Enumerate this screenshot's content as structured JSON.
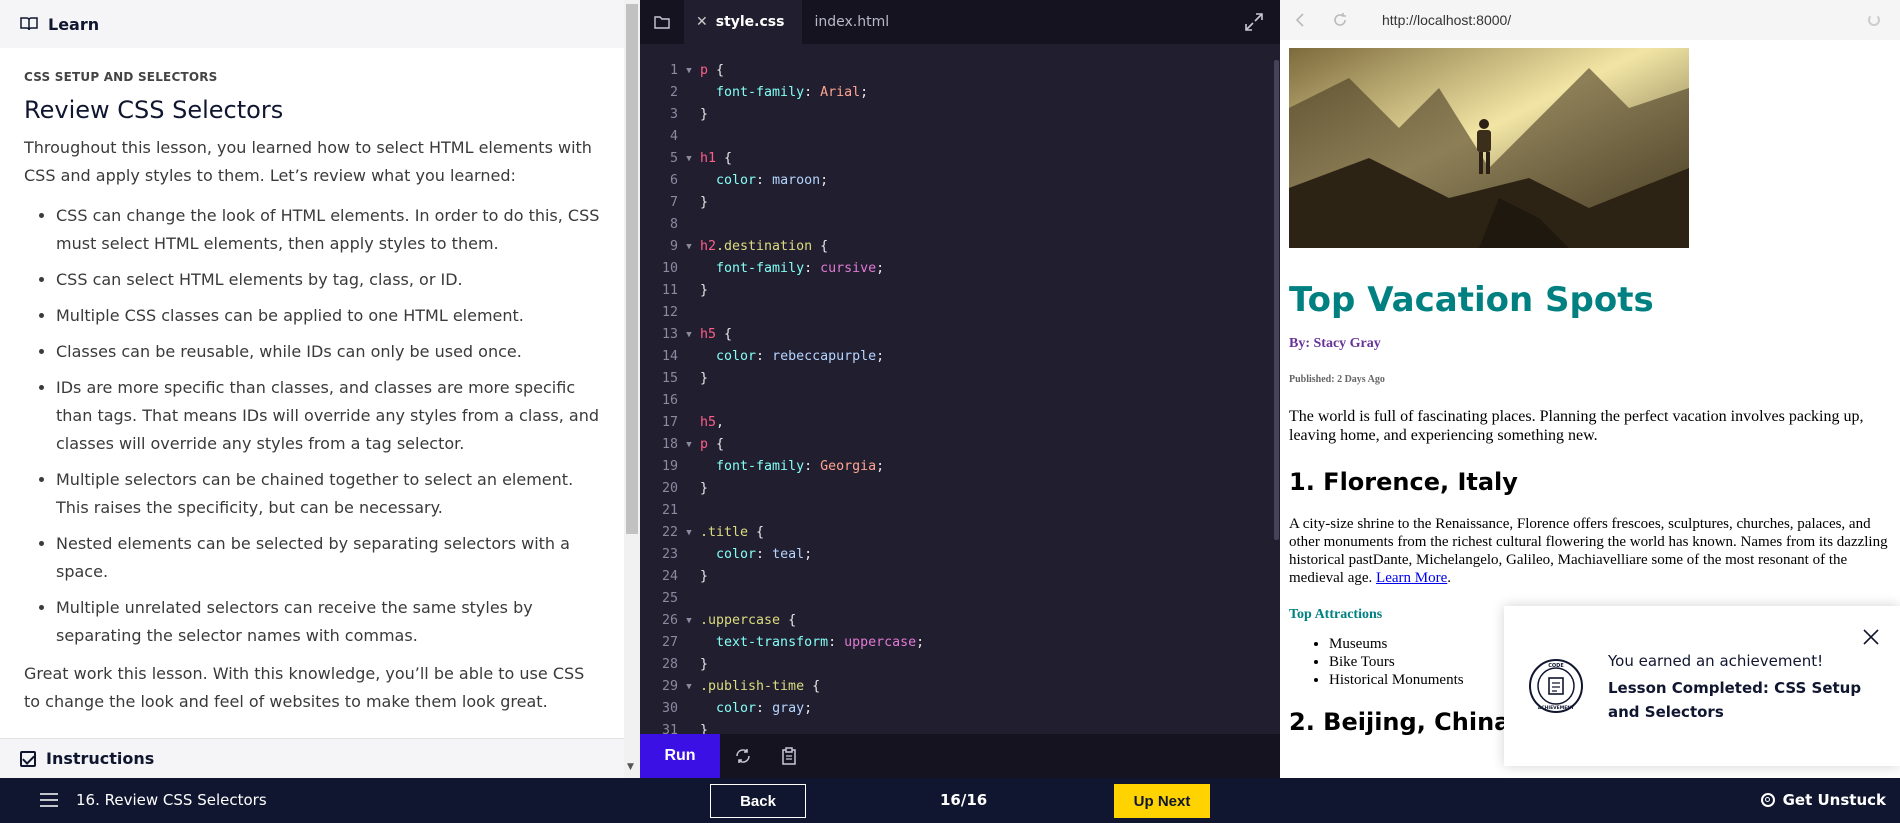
{
  "learn": {
    "header": "Learn",
    "eyebrow": "CSS SETUP AND SELECTORS",
    "title": "Review CSS Selectors",
    "intro": "Throughout this lesson, you learned how to select HTML elements with CSS and apply styles to them. Let’s review what you learned:",
    "bullets": [
      "CSS can change the look of HTML elements. In order to do this, CSS must select HTML elements, then apply styles to them.",
      "CSS can select HTML elements by tag, class, or ID.",
      "Multiple CSS classes can be applied to one HTML element.",
      "Classes can be reusable, while IDs can only be used once.",
      "IDs are more specific than classes, and classes are more specific than tags. That means IDs will override any styles from a class, and classes will override any styles from a tag selector.",
      "Multiple selectors can be chained together to select an element. This raises the specificity, but can be necessary.",
      "Nested elements can be selected by separating selectors with a space.",
      "Multiple unrelated selectors can receive the same styles by separating the selector names with commas."
    ],
    "outro": "Great work this lesson. With this knowledge, you’ll be able to use CSS to change the look and feel of websites to make them look great.",
    "instructions": "Instructions"
  },
  "editor": {
    "tabs": [
      {
        "label": "style.css",
        "active": true
      },
      {
        "label": "index.html",
        "active": false
      }
    ],
    "run_label": "Run",
    "lines": [
      {
        "n": "1",
        "fold": "▼",
        "parts": [
          [
            "t-sel",
            "p"
          ],
          [
            "t-pun",
            " {"
          ]
        ]
      },
      {
        "n": "2",
        "fold": "",
        "parts": [
          [
            "t-pun",
            "  "
          ],
          [
            "t-prop",
            "font-family"
          ],
          [
            "t-pun",
            ": "
          ],
          [
            "t-val",
            "Arial"
          ],
          [
            "t-pun",
            ";"
          ]
        ]
      },
      {
        "n": "3",
        "fold": "",
        "parts": [
          [
            "t-pun",
            "}"
          ]
        ]
      },
      {
        "n": "4",
        "fold": "",
        "parts": []
      },
      {
        "n": "5",
        "fold": "▼",
        "parts": [
          [
            "t-sel",
            "h1"
          ],
          [
            "t-pun",
            " {"
          ]
        ]
      },
      {
        "n": "6",
        "fold": "",
        "parts": [
          [
            "t-pun",
            "  "
          ],
          [
            "t-prop",
            "color"
          ],
          [
            "t-pun",
            ": "
          ],
          [
            "t-kw",
            "maroon"
          ],
          [
            "t-pun",
            ";"
          ]
        ]
      },
      {
        "n": "7",
        "fold": "",
        "parts": [
          [
            "t-pun",
            "}"
          ]
        ]
      },
      {
        "n": "8",
        "fold": "",
        "parts": []
      },
      {
        "n": "9",
        "fold": "▼",
        "parts": [
          [
            "t-sel",
            "h2"
          ],
          [
            "t-cls",
            ".destination"
          ],
          [
            "t-pun",
            " {"
          ]
        ]
      },
      {
        "n": "10",
        "fold": "",
        "parts": [
          [
            "t-pun",
            "  "
          ],
          [
            "t-prop",
            "font-family"
          ],
          [
            "t-pun",
            ": "
          ],
          [
            "t-mag",
            "cursive"
          ],
          [
            "t-pun",
            ";"
          ]
        ]
      },
      {
        "n": "11",
        "fold": "",
        "parts": [
          [
            "t-pun",
            "}"
          ]
        ]
      },
      {
        "n": "12",
        "fold": "",
        "parts": []
      },
      {
        "n": "13",
        "fold": "▼",
        "parts": [
          [
            "t-sel",
            "h5"
          ],
          [
            "t-pun",
            " {"
          ]
        ]
      },
      {
        "n": "14",
        "fold": "",
        "parts": [
          [
            "t-pun",
            "  "
          ],
          [
            "t-prop",
            "color"
          ],
          [
            "t-pun",
            ": "
          ],
          [
            "t-kw",
            "rebeccapurple"
          ],
          [
            "t-pun",
            ";"
          ]
        ]
      },
      {
        "n": "15",
        "fold": "",
        "parts": [
          [
            "t-pun",
            "}"
          ]
        ]
      },
      {
        "n": "16",
        "fold": "",
        "parts": []
      },
      {
        "n": "17",
        "fold": "",
        "parts": [
          [
            "t-sel",
            "h5"
          ],
          [
            "t-pun",
            ","
          ]
        ]
      },
      {
        "n": "18",
        "fold": "▼",
        "parts": [
          [
            "t-sel",
            "p"
          ],
          [
            "t-pun",
            " {"
          ]
        ]
      },
      {
        "n": "19",
        "fold": "",
        "parts": [
          [
            "t-pun",
            "  "
          ],
          [
            "t-prop",
            "font-family"
          ],
          [
            "t-pun",
            ": "
          ],
          [
            "t-val",
            "Georgia"
          ],
          [
            "t-pun",
            ";"
          ]
        ]
      },
      {
        "n": "20",
        "fold": "",
        "parts": [
          [
            "t-pun",
            "}"
          ]
        ]
      },
      {
        "n": "21",
        "fold": "",
        "parts": []
      },
      {
        "n": "22",
        "fold": "▼",
        "parts": [
          [
            "t-cls",
            ".title"
          ],
          [
            "t-pun",
            " {"
          ]
        ]
      },
      {
        "n": "23",
        "fold": "",
        "parts": [
          [
            "t-pun",
            "  "
          ],
          [
            "t-prop",
            "color"
          ],
          [
            "t-pun",
            ": "
          ],
          [
            "t-kw",
            "teal"
          ],
          [
            "t-pun",
            ";"
          ]
        ]
      },
      {
        "n": "24",
        "fold": "",
        "parts": [
          [
            "t-pun",
            "}"
          ]
        ]
      },
      {
        "n": "25",
        "fold": "",
        "parts": []
      },
      {
        "n": "26",
        "fold": "▼",
        "parts": [
          [
            "t-cls",
            ".uppercase"
          ],
          [
            "t-pun",
            " {"
          ]
        ]
      },
      {
        "n": "27",
        "fold": "",
        "parts": [
          [
            "t-pun",
            "  "
          ],
          [
            "t-prop",
            "text-transform"
          ],
          [
            "t-pun",
            ": "
          ],
          [
            "t-mag",
            "uppercase"
          ],
          [
            "t-pun",
            ";"
          ]
        ]
      },
      {
        "n": "28",
        "fold": "",
        "parts": [
          [
            "t-pun",
            "}"
          ]
        ]
      },
      {
        "n": "29",
        "fold": "▼",
        "parts": [
          [
            "t-cls",
            ".publish-time"
          ],
          [
            "t-pun",
            " {"
          ]
        ]
      },
      {
        "n": "30",
        "fold": "",
        "parts": [
          [
            "t-pun",
            "  "
          ],
          [
            "t-prop",
            "color"
          ],
          [
            "t-pun",
            ": "
          ],
          [
            "t-kw",
            "gray"
          ],
          [
            "t-pun",
            ";"
          ]
        ]
      },
      {
        "n": "31",
        "fold": "",
        "parts": [
          [
            "t-pun",
            "}"
          ]
        ]
      }
    ]
  },
  "browser": {
    "url": "http://localhost:8000/",
    "site_title": "Top Vacation Spots",
    "byline": "By: Stacy Gray",
    "published": "Published: 2 Days Ago",
    "intro": "The world is full of fascinating places. Planning the perfect vacation involves packing up, leaving home, and experiencing something new.",
    "dest1": "1. Florence, Italy",
    "desc1": "A city-size shrine to the Renaissance, Florence offers frescoes, sculptures, churches, palaces, and other monuments from the richest cultural flowering the world has known. Names from its dazzling historical pastDante, Michelangelo, Galileo, Machiavelliare some of the most resonant of the medieval age. ",
    "learn_more": "Learn More",
    "desc1_end": ".",
    "attractions_head": "Top Attractions",
    "attractions": [
      "Museums",
      "Bike Tours",
      "Historical Monuments"
    ],
    "dest2": "2. Beijing, China"
  },
  "toast": {
    "eyebrow": "You earned an achievement!",
    "title": "Lesson Completed: CSS Setup and Selectors",
    "badge_text": "CODE ACHIEVEMENT"
  },
  "bottom": {
    "lesson": "16. Review CSS Selectors",
    "back": "Back",
    "progress": "16/16",
    "next": "Up Next",
    "unstuck": "Get Unstuck"
  },
  "colors": {
    "accent": "#3a10e5",
    "next_yellow": "#ffd300",
    "navy": "#10162f",
    "editor_bg": "#211e2f"
  }
}
